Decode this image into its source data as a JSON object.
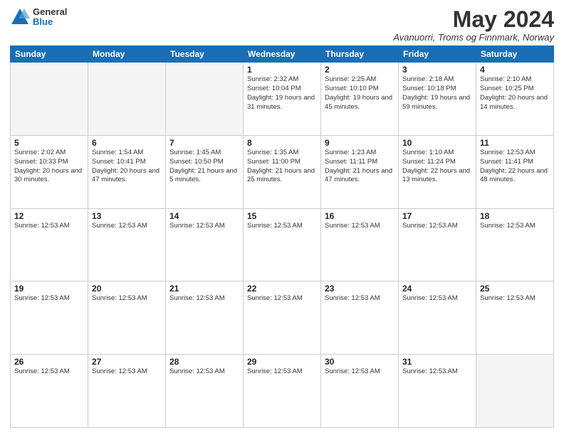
{
  "header": {
    "logo_general": "General",
    "logo_blue": "Blue",
    "month_title": "May 2024",
    "location": "Avanuorri, Troms og Finnmark, Norway"
  },
  "days_of_week": [
    "Sunday",
    "Monday",
    "Tuesday",
    "Wednesday",
    "Thursday",
    "Friday",
    "Saturday"
  ],
  "weeks": [
    [
      {
        "day": "",
        "info": ""
      },
      {
        "day": "",
        "info": ""
      },
      {
        "day": "",
        "info": ""
      },
      {
        "day": "1",
        "info": "Sunrise: 2:32 AM\nSunset: 10:04 PM\nDaylight: 19 hours and 31 minutes."
      },
      {
        "day": "2",
        "info": "Sunrise: 2:25 AM\nSunset: 10:10 PM\nDaylight: 19 hours and 45 minutes."
      },
      {
        "day": "3",
        "info": "Sunrise: 2:18 AM\nSunset: 10:18 PM\nDaylight: 19 hours and 59 minutes."
      },
      {
        "day": "4",
        "info": "Sunrise: 2:10 AM\nSunset: 10:25 PM\nDaylight: 20 hours and 14 minutes."
      }
    ],
    [
      {
        "day": "5",
        "info": "Sunrise: 2:02 AM\nSunset: 10:33 PM\nDaylight: 20 hours and 30 minutes."
      },
      {
        "day": "6",
        "info": "Sunrise: 1:54 AM\nSunset: 10:41 PM\nDaylight: 20 hours and 47 minutes."
      },
      {
        "day": "7",
        "info": "Sunrise: 1:45 AM\nSunset: 10:50 PM\nDaylight: 21 hours and 5 minutes."
      },
      {
        "day": "8",
        "info": "Sunrise: 1:35 AM\nSunset: 11:00 PM\nDaylight: 21 hours and 25 minutes."
      },
      {
        "day": "9",
        "info": "Sunrise: 1:23 AM\nSunset: 11:11 PM\nDaylight: 21 hours and 47 minutes."
      },
      {
        "day": "10",
        "info": "Sunrise: 1:10 AM\nSunset: 11:24 PM\nDaylight: 22 hours and 13 minutes."
      },
      {
        "day": "11",
        "info": "Sunrise: 12:53 AM\nSunset: 11:41 PM\nDaylight: 22 hours and 48 minutes."
      }
    ],
    [
      {
        "day": "12",
        "info": "Sunrise: 12:53 AM"
      },
      {
        "day": "13",
        "info": "Sunrise: 12:53 AM"
      },
      {
        "day": "14",
        "info": "Sunrise: 12:53 AM"
      },
      {
        "day": "15",
        "info": "Sunrise: 12:53 AM"
      },
      {
        "day": "16",
        "info": "Sunrise: 12:53 AM"
      },
      {
        "day": "17",
        "info": "Sunrise: 12:53 AM"
      },
      {
        "day": "18",
        "info": "Sunrise: 12:53 AM"
      }
    ],
    [
      {
        "day": "19",
        "info": "Sunrise: 12:53 AM"
      },
      {
        "day": "20",
        "info": "Sunrise: 12:53 AM"
      },
      {
        "day": "21",
        "info": "Sunrise: 12:53 AM"
      },
      {
        "day": "22",
        "info": "Sunrise: 12:53 AM"
      },
      {
        "day": "23",
        "info": "Sunrise: 12:53 AM"
      },
      {
        "day": "24",
        "info": "Sunrise: 12:53 AM"
      },
      {
        "day": "25",
        "info": "Sunrise: 12:53 AM"
      }
    ],
    [
      {
        "day": "26",
        "info": "Sunrise: 12:53 AM"
      },
      {
        "day": "27",
        "info": "Sunrise: 12:53 AM"
      },
      {
        "day": "28",
        "info": "Sunrise: 12:53 AM"
      },
      {
        "day": "29",
        "info": "Sunrise: 12:53 AM"
      },
      {
        "day": "30",
        "info": "Sunrise: 12:53 AM"
      },
      {
        "day": "31",
        "info": "Sunrise: 12:53 AM"
      },
      {
        "day": "",
        "info": ""
      }
    ]
  ]
}
